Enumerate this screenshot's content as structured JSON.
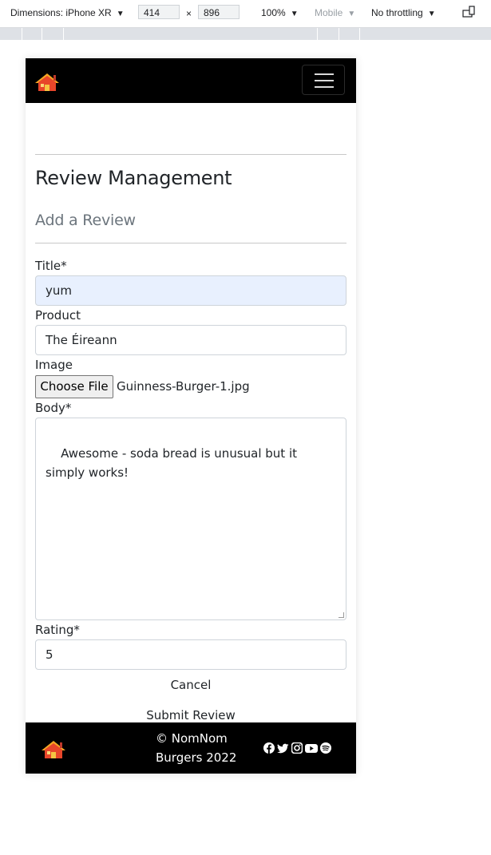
{
  "devtools": {
    "device": "Dimensions: iPhone XR",
    "width": "414",
    "times": "×",
    "height": "896",
    "zoom": "100%",
    "mode": "Mobile",
    "throttle": "No throttling"
  },
  "page": {
    "title": "Review Management",
    "subtitle": "Add a Review",
    "form": {
      "title_label": "Title*",
      "title_value": "yum",
      "product_label": "Product",
      "product_value": "The Éireann",
      "image_label": "Image",
      "choose_file_label": "Choose File",
      "file_name": "Guinness-Burger-1.jpg",
      "body_label": "Body*",
      "body_value": "Awesome - soda bread is unusual but it simply works!",
      "rating_label": "Rating*",
      "rating_value": "5",
      "cancel_label": "Cancel",
      "submit_label": "Submit Review"
    }
  },
  "footer": {
    "copyright_line1": "© NomNom",
    "copyright_line2": "Burgers 2022",
    "social_icons": [
      "facebook-icon",
      "twitter-icon",
      "instagram-icon",
      "youtube-icon",
      "spotify-icon"
    ]
  },
  "colors": {
    "navbar_bg": "#000000",
    "autofill_bg": "#e8f0fe",
    "home_icon_roof": "#f5a623",
    "home_icon_body": "#e8462a"
  }
}
